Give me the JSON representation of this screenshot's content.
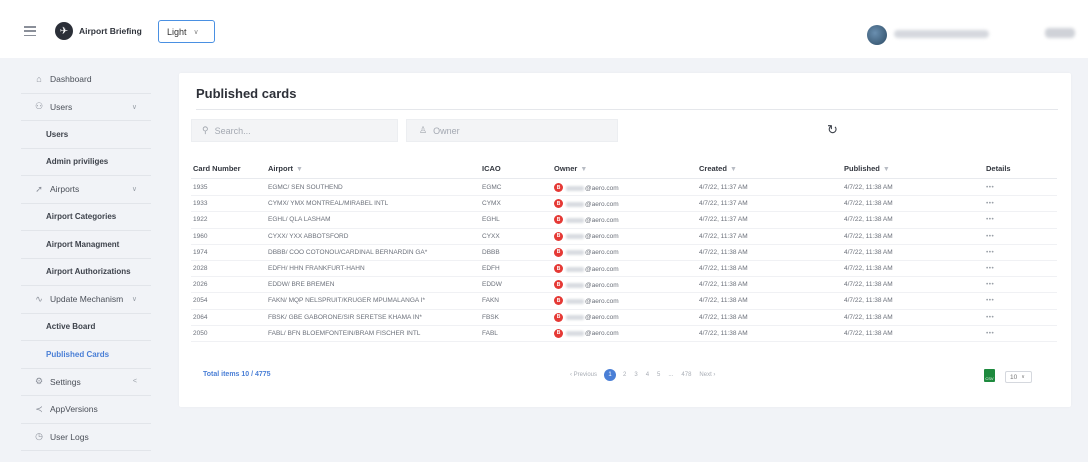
{
  "app": {
    "name": "Airport Briefing",
    "theme": "Light"
  },
  "sidebar": {
    "items": [
      {
        "label": "Dashboard",
        "icon": "home-icon",
        "type": "top"
      },
      {
        "label": "Users",
        "icon": "users-icon",
        "type": "top",
        "caret": "∨"
      },
      {
        "label": "Users",
        "type": "sub"
      },
      {
        "label": "Admin priviliges",
        "type": "sub"
      },
      {
        "label": "Airports",
        "icon": "plane-icon",
        "type": "top",
        "caret": "∨"
      },
      {
        "label": "Airport Categories",
        "type": "sub"
      },
      {
        "label": "Airport Managment",
        "type": "sub"
      },
      {
        "label": "Airport Authorizations",
        "type": "sub"
      },
      {
        "label": "Update Mechanism",
        "icon": "update-icon",
        "type": "top",
        "caret": "∨"
      },
      {
        "label": "Active Board",
        "type": "sub"
      },
      {
        "label": "Published Cards",
        "type": "sub",
        "active": true
      },
      {
        "label": "Settings",
        "icon": "gear-icon",
        "type": "top",
        "caret": "<"
      },
      {
        "label": "AppVersions",
        "icon": "share-icon",
        "type": "top"
      },
      {
        "label": "User Logs",
        "icon": "clock-icon",
        "type": "top"
      }
    ]
  },
  "main": {
    "title": "Published cards",
    "search_placeholder": "Search...",
    "owner_placeholder": "Owner",
    "columns": [
      "Card Number",
      "Airport",
      "ICAO",
      "Owner",
      "Created",
      "Published",
      "Details"
    ],
    "rows": [
      {
        "card": "1935",
        "airport": "EGMC/ SEN SOUTHEND",
        "icao": "EGMC",
        "owner": "@aero.com",
        "created": "4/7/22, 11:37 AM",
        "published": "4/7/22, 11:38 AM"
      },
      {
        "card": "1933",
        "airport": "CYMX/ YMX MONTREAL/MIRABEL INTL",
        "icao": "CYMX",
        "owner": "@aero.com",
        "created": "4/7/22, 11:37 AM",
        "published": "4/7/22, 11:38 AM"
      },
      {
        "card": "1922",
        "airport": "EGHL/ QLA LASHAM",
        "icao": "EGHL",
        "owner": "@aero.com",
        "created": "4/7/22, 11:37 AM",
        "published": "4/7/22, 11:38 AM"
      },
      {
        "card": "1960",
        "airport": "CYXX/ YXX ABBOTSFORD",
        "icao": "CYXX",
        "owner": "@aero.com",
        "created": "4/7/22, 11:37 AM",
        "published": "4/7/22, 11:38 AM"
      },
      {
        "card": "1974",
        "airport": "DBBB/ COO COTONOU/CARDINAL BERNARDIN GA*",
        "icao": "DBBB",
        "owner": "@aero.com",
        "created": "4/7/22, 11:38 AM",
        "published": "4/7/22, 11:38 AM"
      },
      {
        "card": "2028",
        "airport": "EDFH/ HHN FRANKFURT-HAHN",
        "icao": "EDFH",
        "owner": "@aero.com",
        "created": "4/7/22, 11:38 AM",
        "published": "4/7/22, 11:38 AM"
      },
      {
        "card": "2026",
        "airport": "EDDW/ BRE BREMEN",
        "icao": "EDDW",
        "owner": "@aero.com",
        "created": "4/7/22, 11:38 AM",
        "published": "4/7/22, 11:38 AM"
      },
      {
        "card": "2054",
        "airport": "FAKN/ MQP NELSPRUIT/KRUGER MPUMALANGA I*",
        "icao": "FAKN",
        "owner": "@aero.com",
        "created": "4/7/22, 11:38 AM",
        "published": "4/7/22, 11:38 AM"
      },
      {
        "card": "2064",
        "airport": "FBSK/ GBE GABORONE/SIR SERETSE KHAMA IN*",
        "icao": "FBSK",
        "owner": "@aero.com",
        "created": "4/7/22, 11:38 AM",
        "published": "4/7/22, 11:38 AM"
      },
      {
        "card": "2050",
        "airport": "FABL/ BFN BLOEMFONTEIN/BRAM FISCHER INTL",
        "icao": "FABL",
        "owner": "@aero.com",
        "created": "4/7/22, 11:38 AM",
        "published": "4/7/22, 11:38 AM"
      }
    ],
    "details_label": "•••",
    "total": "Total items 10 / 4775",
    "pagination": {
      "previous": "‹ Previous",
      "pages": [
        "1",
        "2",
        "3",
        "4",
        "5",
        "...",
        "478"
      ],
      "current": "1",
      "next": "Next ›"
    },
    "page_size": "10"
  },
  "colors": {
    "accent": "#4a7fd6",
    "owner_badge": "#e53935",
    "excel_green": "#1e8a3e"
  }
}
